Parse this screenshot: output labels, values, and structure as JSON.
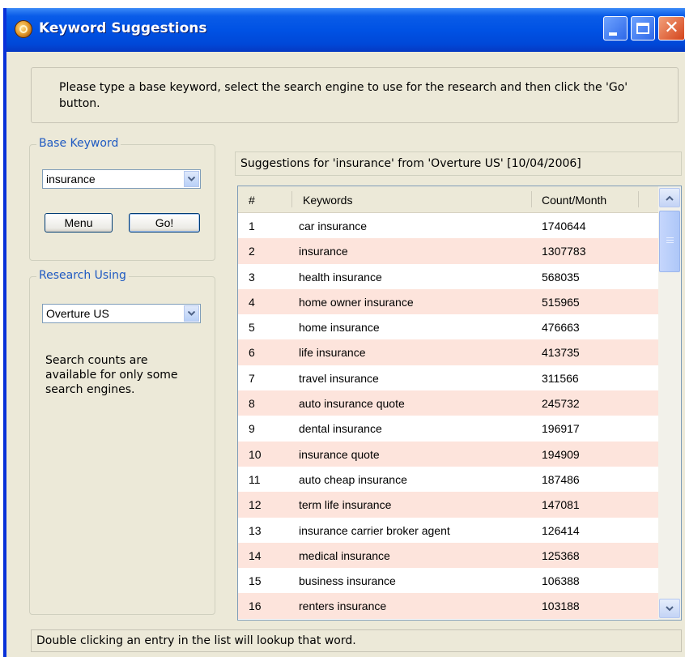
{
  "window": {
    "title": "Keyword Suggestions",
    "controls": [
      "minimize-icon",
      "maximize-icon",
      "close-icon"
    ]
  },
  "instructions": "Please type a base keyword, select the search engine to use for the research and then click the 'Go' button.",
  "base_keyword": {
    "label": "Base Keyword",
    "value": "insurance",
    "menu_label": "Menu",
    "go_label": "Go!"
  },
  "research": {
    "label": "Research Using",
    "engine": "Overture US",
    "note": "Search counts are available for only some search engines."
  },
  "suggestions": {
    "header": "Suggestions for 'insurance' from 'Overture US' [10/04/2006]",
    "columns": [
      "#",
      "Keywords",
      "Count/Month"
    ],
    "rows": [
      [
        "1",
        "car insurance",
        "1740644"
      ],
      [
        "2",
        "insurance",
        "1307783"
      ],
      [
        "3",
        "health insurance",
        "568035"
      ],
      [
        "4",
        "home owner insurance",
        "515965"
      ],
      [
        "5",
        "home insurance",
        "476663"
      ],
      [
        "6",
        "life insurance",
        "413735"
      ],
      [
        "7",
        "travel insurance",
        "311566"
      ],
      [
        "8",
        "auto insurance quote",
        "245732"
      ],
      [
        "9",
        "dental insurance",
        "196917"
      ],
      [
        "10",
        "insurance quote",
        "194909"
      ],
      [
        "11",
        "auto cheap insurance",
        "187486"
      ],
      [
        "12",
        "term life insurance",
        "147081"
      ],
      [
        "13",
        "insurance carrier broker agent",
        "126414"
      ],
      [
        "14",
        "medical insurance",
        "125368"
      ],
      [
        "15",
        "business insurance",
        "106388"
      ],
      [
        "16",
        "renters insurance",
        "103188"
      ]
    ]
  },
  "status": "Double clicking an entry in the list will lookup that word.",
  "colors": {
    "titlebar": "#0052e4",
    "row_alt": "#fde4dc",
    "group_label": "#1f5ac2"
  }
}
